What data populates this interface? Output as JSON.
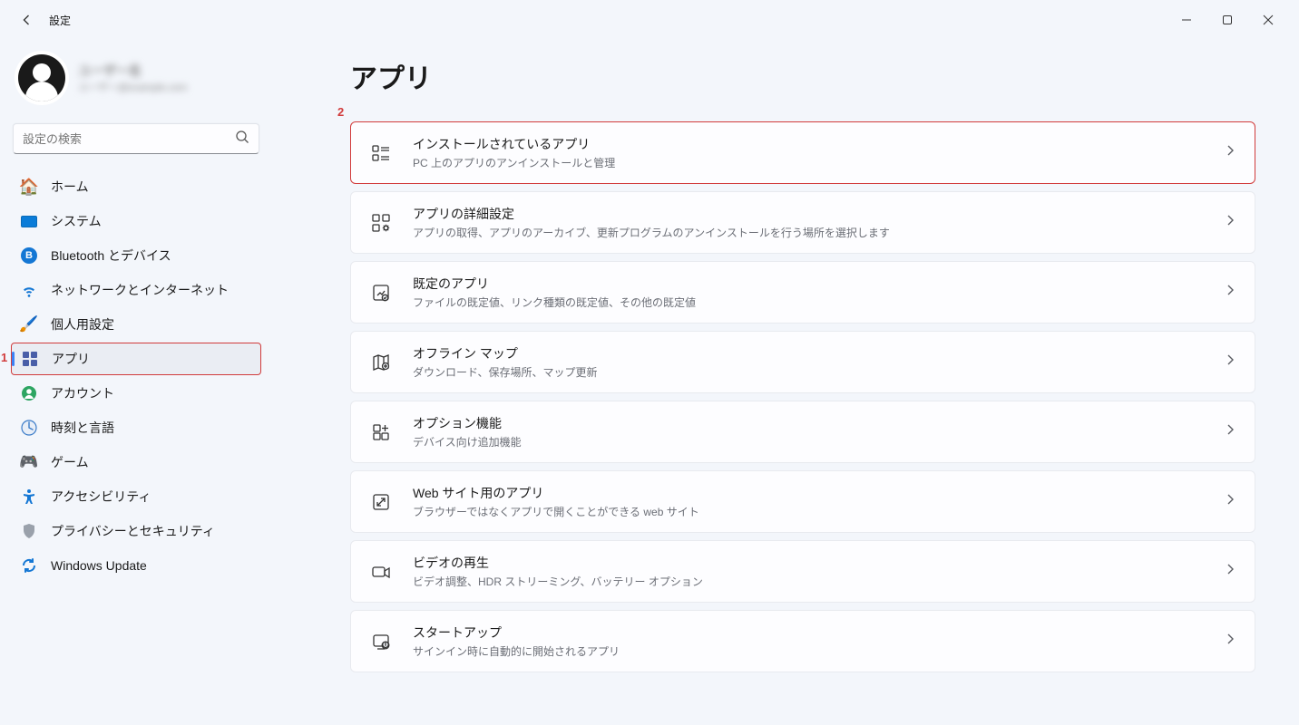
{
  "titlebar": {
    "app_title": "設定"
  },
  "profile": {
    "name_masked": "ユーザー名",
    "email_masked": "ユーザー@example.com"
  },
  "search": {
    "placeholder": "設定の検索"
  },
  "sidebar": {
    "items": [
      {
        "label": "ホーム",
        "icon": "home-icon"
      },
      {
        "label": "システム",
        "icon": "system-icon"
      },
      {
        "label": "Bluetooth とデバイス",
        "icon": "bluetooth-icon"
      },
      {
        "label": "ネットワークとインターネット",
        "icon": "network-icon"
      },
      {
        "label": "個人用設定",
        "icon": "personalize-icon"
      },
      {
        "label": "アプリ",
        "icon": "apps-icon"
      },
      {
        "label": "アカウント",
        "icon": "accounts-icon"
      },
      {
        "label": "時刻と言語",
        "icon": "time-language-icon"
      },
      {
        "label": "ゲーム",
        "icon": "gaming-icon"
      },
      {
        "label": "アクセシビリティ",
        "icon": "accessibility-icon"
      },
      {
        "label": "プライバシーとセキュリティ",
        "icon": "privacy-icon"
      },
      {
        "label": "Windows Update",
        "icon": "update-icon"
      }
    ],
    "active_index": 5,
    "annotated_index": 5
  },
  "page": {
    "title": "アプリ"
  },
  "annotations": {
    "label_1": "1",
    "label_2": "2",
    "highlight_card_index": 0
  },
  "cards": [
    {
      "icon": "installed-apps-icon",
      "title": "インストールされているアプリ",
      "sub": "PC 上のアプリのアンインストールと管理"
    },
    {
      "icon": "advanced-apps-icon",
      "title": "アプリの詳細設定",
      "sub": "アプリの取得、アプリのアーカイブ、更新プログラムのアンインストールを行う場所を選択します"
    },
    {
      "icon": "default-apps-icon",
      "title": "既定のアプリ",
      "sub": "ファイルの既定値、リンク種類の既定値、その他の既定値"
    },
    {
      "icon": "offline-maps-icon",
      "title": "オフライン マップ",
      "sub": "ダウンロード、保存場所、マップ更新"
    },
    {
      "icon": "optional-features-icon",
      "title": "オプション機能",
      "sub": "デバイス向け追加機能"
    },
    {
      "icon": "websites-apps-icon",
      "title": "Web サイト用のアプリ",
      "sub": "ブラウザーではなくアプリで開くことができる web サイト"
    },
    {
      "icon": "video-playback-icon",
      "title": "ビデオの再生",
      "sub": "ビデオ調整、HDR ストリーミング、バッテリー オプション"
    },
    {
      "icon": "startup-icon",
      "title": "スタートアップ",
      "sub": "サインイン時に自動的に開始されるアプリ"
    }
  ]
}
